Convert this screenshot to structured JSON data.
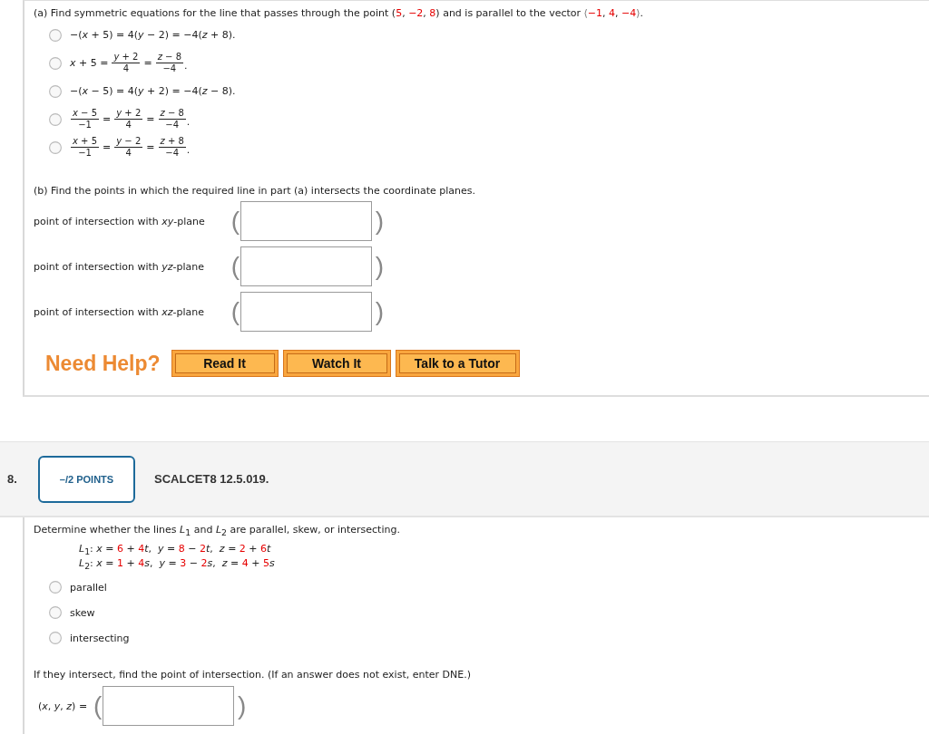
{
  "part_a": {
    "prompt": [
      {
        "kind": "text",
        "text": "(a) Find symmetric equations for the line that passes through the point ("
      },
      {
        "kind": "given",
        "text": "5"
      },
      {
        "kind": "text",
        "text": ", "
      },
      {
        "kind": "given",
        "text": "−2"
      },
      {
        "kind": "text",
        "text": ", "
      },
      {
        "kind": "given",
        "text": "8"
      },
      {
        "kind": "text",
        "text": ") and is parallel to the vector "
      },
      {
        "kind": "bracket",
        "text": "⟨"
      },
      {
        "kind": "given",
        "text": "−1"
      },
      {
        "kind": "text",
        "text": ", "
      },
      {
        "kind": "given",
        "text": "4"
      },
      {
        "kind": "text",
        "text": ", "
      },
      {
        "kind": "given",
        "text": "−4"
      },
      {
        "kind": "bracket",
        "text": "⟩"
      },
      {
        "kind": "text",
        "text": "."
      }
    ],
    "choices": [
      {
        "selected": false,
        "terms": [
          {
            "kind": "text",
            "text": "−(*x* + 5) = 4(*y* − 2) = −4(*z* + 8)."
          }
        ]
      },
      {
        "selected": false,
        "terms": [
          {
            "kind": "text",
            "text": "*x* + 5 ="
          },
          {
            "kind": "fraction",
            "numerator": "*y* + 2",
            "denominator": "4"
          },
          {
            "kind": "text",
            "text": "="
          },
          {
            "kind": "fraction",
            "numerator": "*z* − 8",
            "denominator": "−4"
          },
          {
            "kind": "text",
            "text": "."
          }
        ]
      },
      {
        "selected": false,
        "terms": [
          {
            "kind": "text",
            "text": "−(*x* − 5) = 4(*y* + 2) = −4(*z* − 8)."
          }
        ]
      },
      {
        "selected": false,
        "terms": [
          {
            "kind": "fraction",
            "numerator": "*x* − 5",
            "denominator": "−1"
          },
          {
            "kind": "text",
            "text": "="
          },
          {
            "kind": "fraction",
            "numerator": "*y* + 2",
            "denominator": "4"
          },
          {
            "kind": "text",
            "text": "="
          },
          {
            "kind": "fraction",
            "numerator": "*z* − 8",
            "denominator": "−4"
          },
          {
            "kind": "text",
            "text": "."
          }
        ]
      },
      {
        "selected": false,
        "terms": [
          {
            "kind": "fraction",
            "numerator": "*x* + 5",
            "denominator": "−1"
          },
          {
            "kind": "text",
            "text": "="
          },
          {
            "kind": "fraction",
            "numerator": "*y* − 2",
            "denominator": "4"
          },
          {
            "kind": "text",
            "text": "="
          },
          {
            "kind": "fraction",
            "numerator": "*z* + 8",
            "denominator": "−4"
          },
          {
            "kind": "text",
            "text": "."
          }
        ]
      }
    ]
  },
  "part_b": {
    "prompt": "(b) Find the points in which the required line in part (a) intersects the coordinate planes.",
    "answers": [
      {
        "label": "point of intersection with *xy*-plane",
        "left_paren": "(",
        "right_paren": ")"
      },
      {
        "label": "point of intersection with *yz*-plane",
        "left_paren": "(",
        "right_paren": ")"
      },
      {
        "label": "point of intersection with *xz*-plane",
        "left_paren": "(",
        "right_paren": ")"
      }
    ]
  },
  "help": {
    "title": "Need Help?",
    "buttons": [
      "Read It",
      "Watch It",
      "Talk to a Tutor"
    ]
  },
  "question": {
    "number": "8.",
    "points": "–/2 POINTS",
    "code": "SCALCET8 12.5.019."
  },
  "problem": {
    "prompt": "Determine whether the lines *L*$_{1}$ and *L*$_{2}$ are parallel, skew, or intersecting.",
    "lines": [
      [
        {
          "kind": "text",
          "text": "*L*$_{1}$: *x* = "
        },
        {
          "kind": "given",
          "text": "6"
        },
        {
          "kind": "text",
          "text": " + "
        },
        {
          "kind": "given",
          "text": "4"
        },
        {
          "kind": "text",
          "text": "*t*,  *y* = "
        },
        {
          "kind": "given",
          "text": "8"
        },
        {
          "kind": "text",
          "text": " − "
        },
        {
          "kind": "given",
          "text": "2"
        },
        {
          "kind": "text",
          "text": "*t*,  *z* = "
        },
        {
          "kind": "given",
          "text": "2"
        },
        {
          "kind": "text",
          "text": " + "
        },
        {
          "kind": "given",
          "text": "6"
        },
        {
          "kind": "text",
          "text": "*t*"
        }
      ],
      [
        {
          "kind": "text",
          "text": "*L*$_{2}$: *x* = "
        },
        {
          "kind": "given",
          "text": "1"
        },
        {
          "kind": "text",
          "text": " + "
        },
        {
          "kind": "given",
          "text": "4"
        },
        {
          "kind": "text",
          "text": "*s*,  *y* = "
        },
        {
          "kind": "given",
          "text": "3"
        },
        {
          "kind": "text",
          "text": " − "
        },
        {
          "kind": "given",
          "text": "2"
        },
        {
          "kind": "text",
          "text": "*s*,  *z* = "
        },
        {
          "kind": "given",
          "text": "4"
        },
        {
          "kind": "text",
          "text": " + "
        },
        {
          "kind": "given",
          "text": "5"
        },
        {
          "kind": "text",
          "text": "*s*"
        }
      ]
    ],
    "choices": [
      {
        "label": "parallel",
        "selected": false
      },
      {
        "label": "skew",
        "selected": false
      },
      {
        "label": "intersecting",
        "selected": false
      }
    ],
    "follow_up": "If they intersect, find the point of intersection. (If an answer does not exist, enter DNE.)",
    "answer": {
      "label": "(*x*, *y*, *z*) =",
      "left_paren": "(",
      "right_paren": ")"
    }
  }
}
